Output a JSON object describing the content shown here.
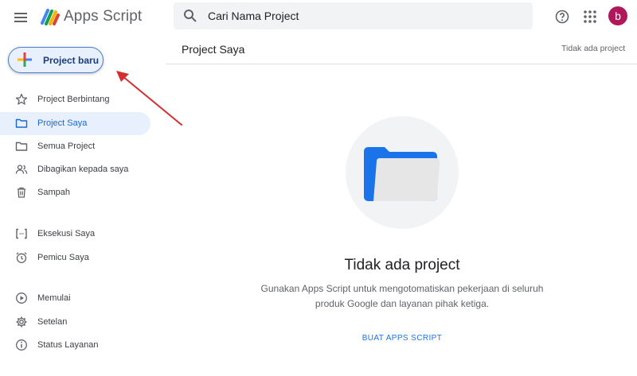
{
  "header": {
    "app_title": "Apps Script",
    "search_placeholder": "Cari Nama Project",
    "avatar_letter": "b"
  },
  "new_project_button": {
    "label": "Project baru"
  },
  "sidebar": {
    "items": [
      {
        "label": "Project Berbintang",
        "icon": "star-icon"
      },
      {
        "label": "Project Saya",
        "icon": "folder-icon",
        "active": true
      },
      {
        "label": "Semua Project",
        "icon": "folder-icon"
      },
      {
        "label": "Dibagikan kepada saya",
        "icon": "people-icon"
      },
      {
        "label": "Sampah",
        "icon": "trash-icon"
      },
      {
        "label": "Eksekusi Saya",
        "icon": "executions-icon"
      },
      {
        "label": "Pemicu Saya",
        "icon": "alarm-icon"
      },
      {
        "label": "Memulai",
        "icon": "play-circle-icon"
      },
      {
        "label": "Setelan",
        "icon": "gear-icon"
      },
      {
        "label": "Status Layanan",
        "icon": "info-icon"
      }
    ]
  },
  "main": {
    "title": "Project Saya",
    "header_status": "Tidak ada project",
    "empty_heading": "Tidak ada project",
    "empty_description_line1": "Gunakan Apps Script untuk mengotomatiskan pekerjaan di seluruh",
    "empty_description_line2": "produk Google dan layanan pihak ketiga.",
    "create_link": "BUAT APPS SCRIPT"
  },
  "colors": {
    "accent": "#1a73e8",
    "active_bg": "#e8f0fe",
    "arrow": "#d32f2f",
    "avatar": "#b0185c"
  }
}
